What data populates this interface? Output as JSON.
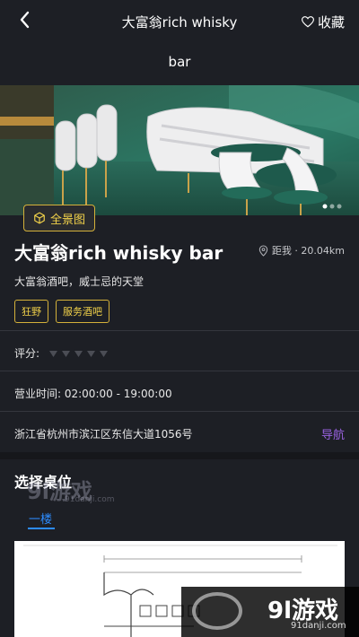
{
  "header": {
    "title_line1": "大富翁rich whisky",
    "title_line2": "bar",
    "favorite_label": "收藏"
  },
  "hero": {
    "panorama_label": "全景图"
  },
  "venue": {
    "name": "大富翁rich whisky bar",
    "distance": "距我 · 20.04km",
    "description": "大富翁酒吧，威士忌的天堂",
    "tags": [
      "狂野",
      "服务酒吧"
    ]
  },
  "info": {
    "rating_label": "评分:",
    "rating_value": 0,
    "rating_max": 5,
    "hours": "营业时间:  02:00:00 - 19:00:00",
    "address": "浙江省杭州市滨江区东信大道1056号",
    "nav_label": "导航"
  },
  "seating": {
    "section_title": "选择桌位",
    "floor_tab": "一楼"
  },
  "watermark": {
    "top_text": "9l游戏",
    "top_sub": "91danji.com",
    "bottom_text": "9l游戏",
    "bottom_sub": "91danji.com"
  },
  "colors": {
    "background": "#1d1f25",
    "accent_gold": "#f2d24a",
    "nav_purple": "#9b63e3",
    "tab_blue": "#2d8cff"
  }
}
